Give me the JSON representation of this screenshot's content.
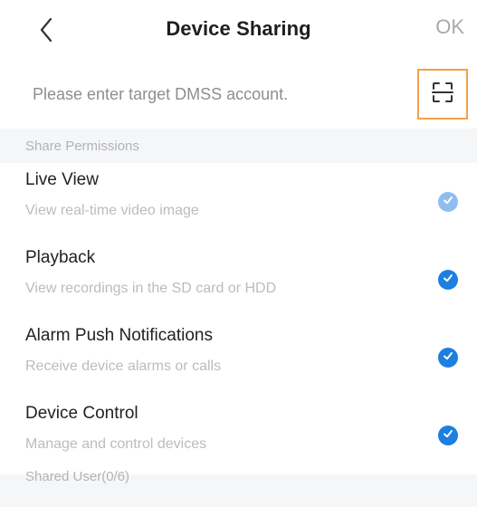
{
  "header": {
    "title": "Device Sharing",
    "ok_label": "OK"
  },
  "account": {
    "placeholder": "Please enter target DMSS account.",
    "value": ""
  },
  "permissions": {
    "section_label": "Share Permissions",
    "items": [
      {
        "title": "Live View",
        "description": "View real-time video image",
        "checked": true,
        "enabled": false
      },
      {
        "title": "Playback",
        "description": "View recordings in the SD card or HDD",
        "checked": true,
        "enabled": true
      },
      {
        "title": "Alarm Push Notifications",
        "description": "Receive device alarms or calls",
        "checked": true,
        "enabled": true
      },
      {
        "title": "Device Control",
        "description": "Manage and control devices",
        "checked": true,
        "enabled": true
      }
    ]
  },
  "shared_users": {
    "label": "Shared User(0/6)"
  },
  "icons": {
    "back": "chevron-left-icon",
    "scan": "qr-scan-icon",
    "check": "checkmark-icon"
  },
  "colors": {
    "accent": "#1d7fe0",
    "accent_disabled": "#8fbeee",
    "scan_highlight": "#f5a04a"
  }
}
